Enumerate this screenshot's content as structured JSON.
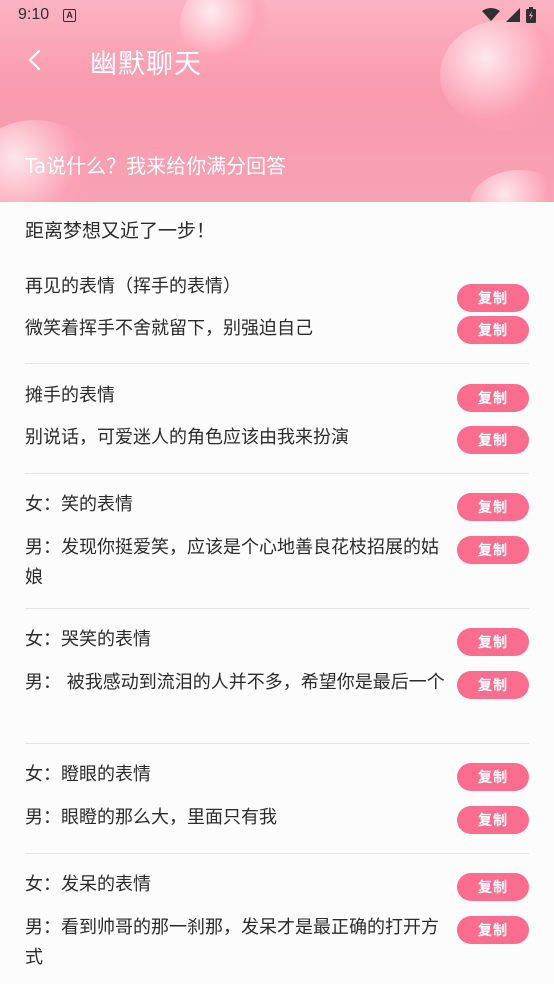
{
  "status_bar": {
    "time": "9:10",
    "badge": "A"
  },
  "header": {
    "title": "幽默聊天",
    "subtitle": "Ta说什么？我来给你满分回答"
  },
  "intro": "距离梦想又近了一步！",
  "copy_label": "复制",
  "groups": [
    {
      "lines": [
        "再见的表情（挥手的表情）",
        "微笑着挥手不舍就留下，别强迫自己"
      ]
    },
    {
      "lines": [
        "摊手的表情",
        "别说话，可爱迷人的角色应该由我来扮演"
      ]
    },
    {
      "lines": [
        "女：笑的表情",
        "男：发现你挺爱笑，应该是个心地善良花枝招展的姑娘"
      ]
    },
    {
      "lines": [
        "女：哭笑的表情",
        "男： 被我感动到流泪的人并不多，希望你是最后一个"
      ]
    },
    {
      "lines": [
        "女：瞪眼的表情",
        "男：眼瞪的那么大，里面只有我"
      ]
    },
    {
      "lines": [
        "女：发呆的表情",
        "男：看到帅哥的那一刹那，发呆才是最正确的打开方式"
      ]
    }
  ],
  "colors": {
    "accent": "#fb6d8f",
    "header_top": "#fbb3c2",
    "header_bottom": "#f7a2b4"
  }
}
